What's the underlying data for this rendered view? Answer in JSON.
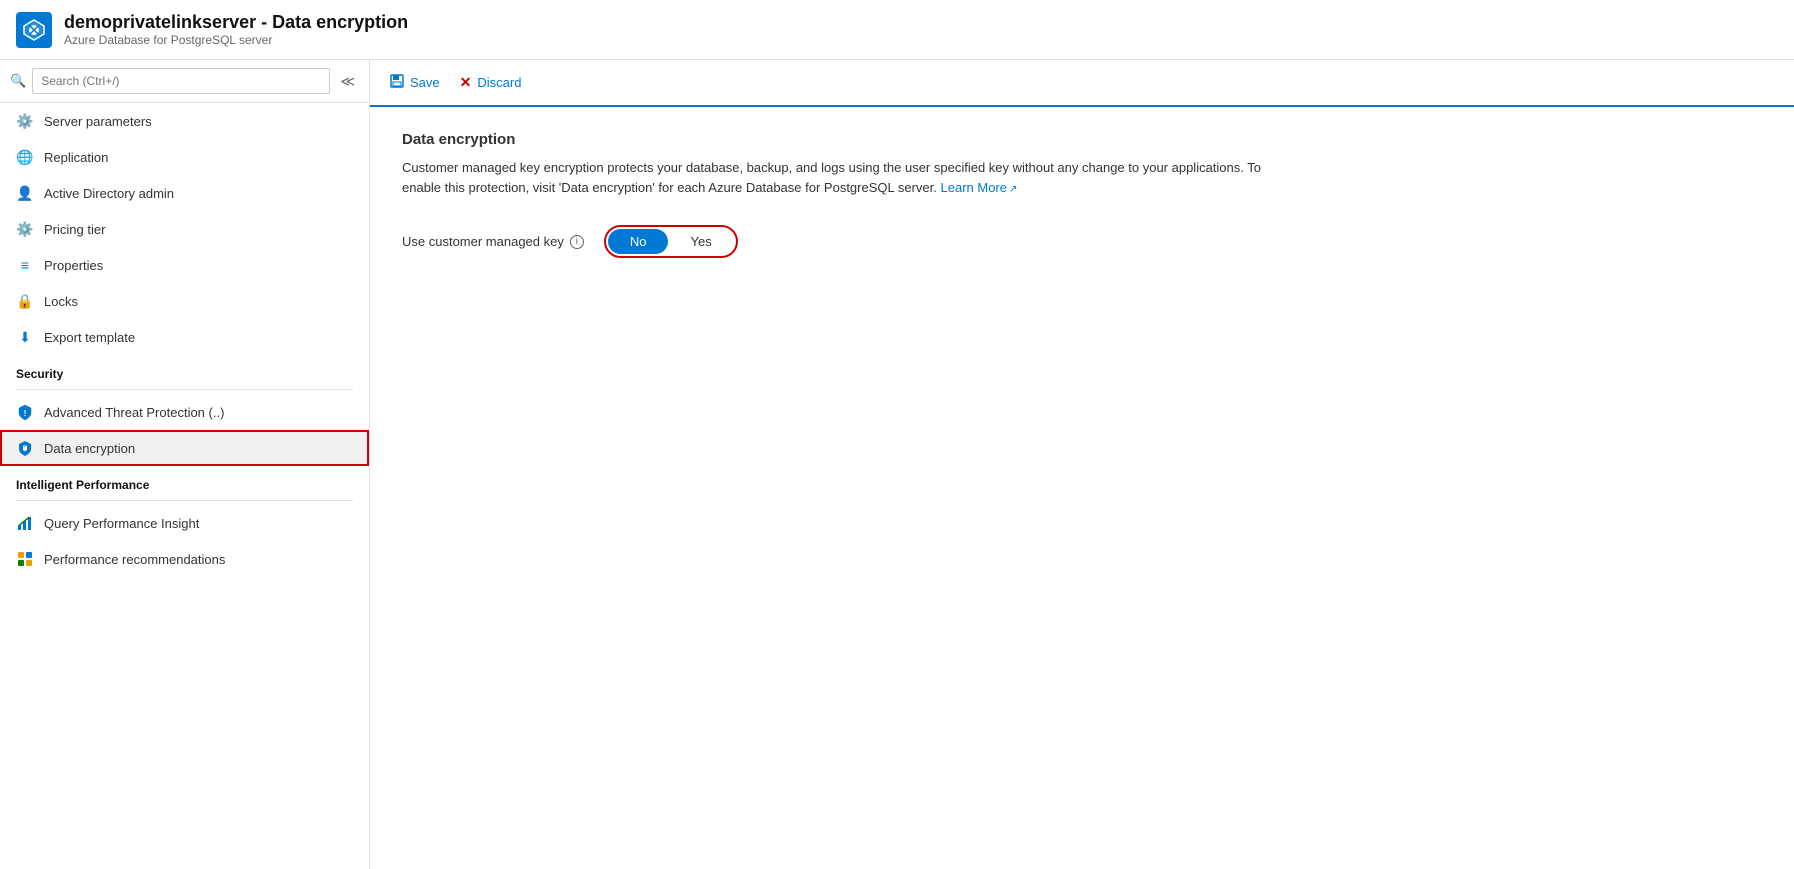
{
  "header": {
    "title": "demoprivatelinkserver - Data encryption",
    "subtitle": "Azure Database for PostgreSQL server",
    "icon_label": "azure-postgresql-icon"
  },
  "sidebar": {
    "search_placeholder": "Search (Ctrl+/)",
    "nav_items": [
      {
        "id": "server-parameters",
        "label": "Server parameters",
        "icon": "gear",
        "section": null,
        "active": false
      },
      {
        "id": "replication",
        "label": "Replication",
        "icon": "globe",
        "section": null,
        "active": false
      },
      {
        "id": "active-directory-admin",
        "label": "Active Directory admin",
        "icon": "people",
        "section": null,
        "active": false
      },
      {
        "id": "pricing-tier",
        "label": "Pricing tier",
        "icon": "tag",
        "section": null,
        "active": false
      },
      {
        "id": "properties",
        "label": "Properties",
        "icon": "bars",
        "section": null,
        "active": false
      },
      {
        "id": "locks",
        "label": "Locks",
        "icon": "lock",
        "section": null,
        "active": false
      },
      {
        "id": "export-template",
        "label": "Export template",
        "icon": "download",
        "section": null,
        "active": false
      }
    ],
    "sections": [
      {
        "title": "Security",
        "items": [
          {
            "id": "advanced-threat-protection",
            "label": "Advanced Threat Protection (..)",
            "icon": "shield-warn",
            "active": false
          },
          {
            "id": "data-encryption",
            "label": "Data encryption",
            "icon": "shield-blue",
            "active": true
          }
        ]
      },
      {
        "title": "Intelligent Performance",
        "items": [
          {
            "id": "query-performance-insight",
            "label": "Query Performance Insight",
            "icon": "chart",
            "active": false
          },
          {
            "id": "performance-recommendations",
            "label": "Performance recommendations",
            "icon": "grid",
            "active": false
          }
        ]
      }
    ]
  },
  "toolbar": {
    "save_label": "Save",
    "discard_label": "Discard"
  },
  "main": {
    "title": "Data encryption",
    "description": "Customer managed key encryption protects your database, backup, and logs using the user specified key without any change to your applications. To enable this protection, visit 'Data encryption' for each Azure Database for PostgreSQL server.",
    "learn_more_label": "Learn More",
    "field_label": "Use customer managed key",
    "toggle": {
      "no_label": "No",
      "yes_label": "Yes",
      "selected": "No"
    }
  }
}
